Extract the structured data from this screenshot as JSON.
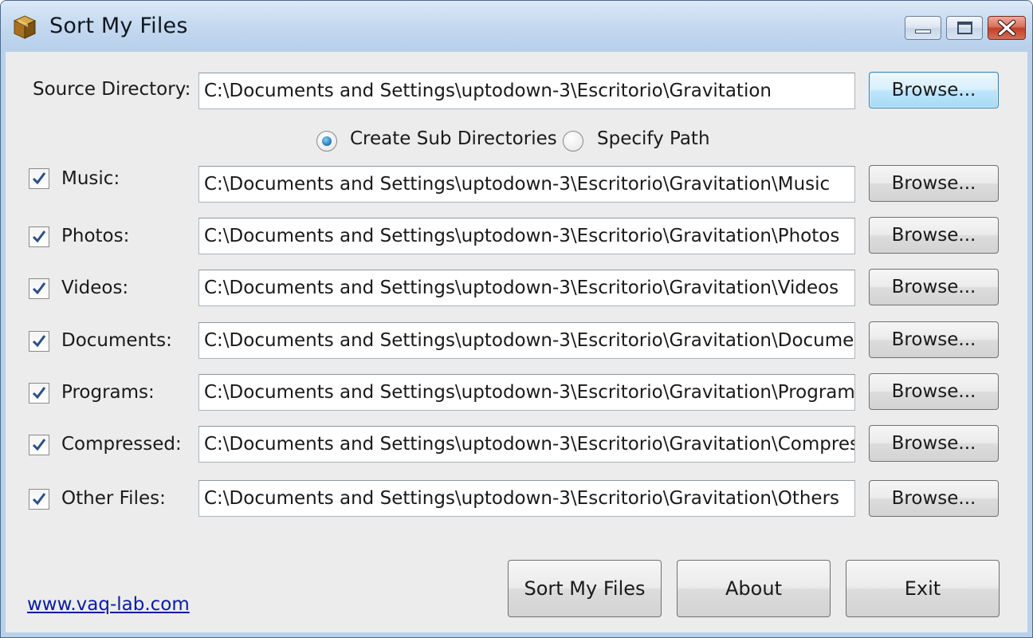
{
  "window": {
    "title": "Sort My Files",
    "icon": "box-icon"
  },
  "source": {
    "label": "Source Directory:",
    "value": "C:\\Documents and Settings\\uptodown-3\\Escritorio\\Gravitation",
    "browse_label": "Browse..."
  },
  "mode": {
    "options": [
      {
        "label": "Create Sub Directories",
        "selected": true
      },
      {
        "label": "Specify Path",
        "selected": false
      }
    ]
  },
  "categories": [
    {
      "label": "Music:",
      "checked": true,
      "path": "C:\\Documents and Settings\\uptodown-3\\Escritorio\\Gravitation\\Music",
      "browse_label": "Browse..."
    },
    {
      "label": "Photos:",
      "checked": true,
      "path": "C:\\Documents and Settings\\uptodown-3\\Escritorio\\Gravitation\\Photos",
      "browse_label": "Browse..."
    },
    {
      "label": "Videos:",
      "checked": true,
      "path": "C:\\Documents and Settings\\uptodown-3\\Escritorio\\Gravitation\\Videos",
      "browse_label": "Browse..."
    },
    {
      "label": "Documents:",
      "checked": true,
      "path": "C:\\Documents and Settings\\uptodown-3\\Escritorio\\Gravitation\\Documents",
      "browse_label": "Browse..."
    },
    {
      "label": "Programs:",
      "checked": true,
      "path": "C:\\Documents and Settings\\uptodown-3\\Escritorio\\Gravitation\\Programs",
      "browse_label": "Browse..."
    },
    {
      "label": "Compressed:",
      "checked": true,
      "path": "C:\\Documents and Settings\\uptodown-3\\Escritorio\\Gravitation\\Compressed",
      "browse_label": "Browse..."
    },
    {
      "label": "Other Files:",
      "checked": true,
      "path": "C:\\Documents and Settings\\uptodown-3\\Escritorio\\Gravitation\\Others",
      "browse_label": "Browse..."
    }
  ],
  "footer": {
    "website": "www.vaq-lab.com",
    "sort_label": "Sort My Files",
    "about_label": "About",
    "exit_label": "Exit"
  },
  "colors": {
    "titlebar": "#c6daf0",
    "client_bg": "#ececec",
    "link": "#0a1ba8",
    "close_button": "#c0412a",
    "check_mark": "#2b4f8a"
  }
}
